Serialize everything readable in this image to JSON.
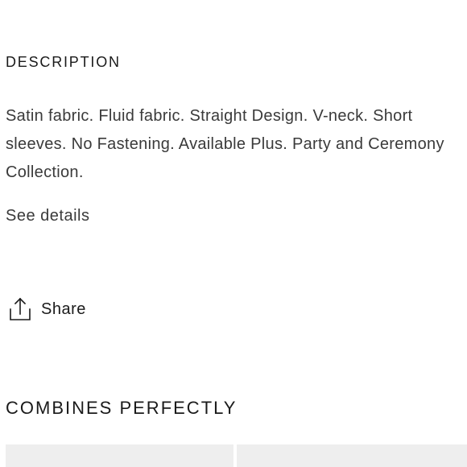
{
  "description_section": {
    "title": "DESCRIPTION",
    "text": "Satin fabric. Fluid fabric. Straight Design. V-neck. Short sleeves. No Fastening. Available Plus. Party and Ceremony Collection.",
    "see_details_label": "See details"
  },
  "share": {
    "label": "Share",
    "icon": "share-icon"
  },
  "combines_section": {
    "title": "COMBINES PERFECTLY",
    "cards": [
      {
        "name": "product-card-1"
      },
      {
        "name": "product-card-2"
      }
    ]
  }
}
